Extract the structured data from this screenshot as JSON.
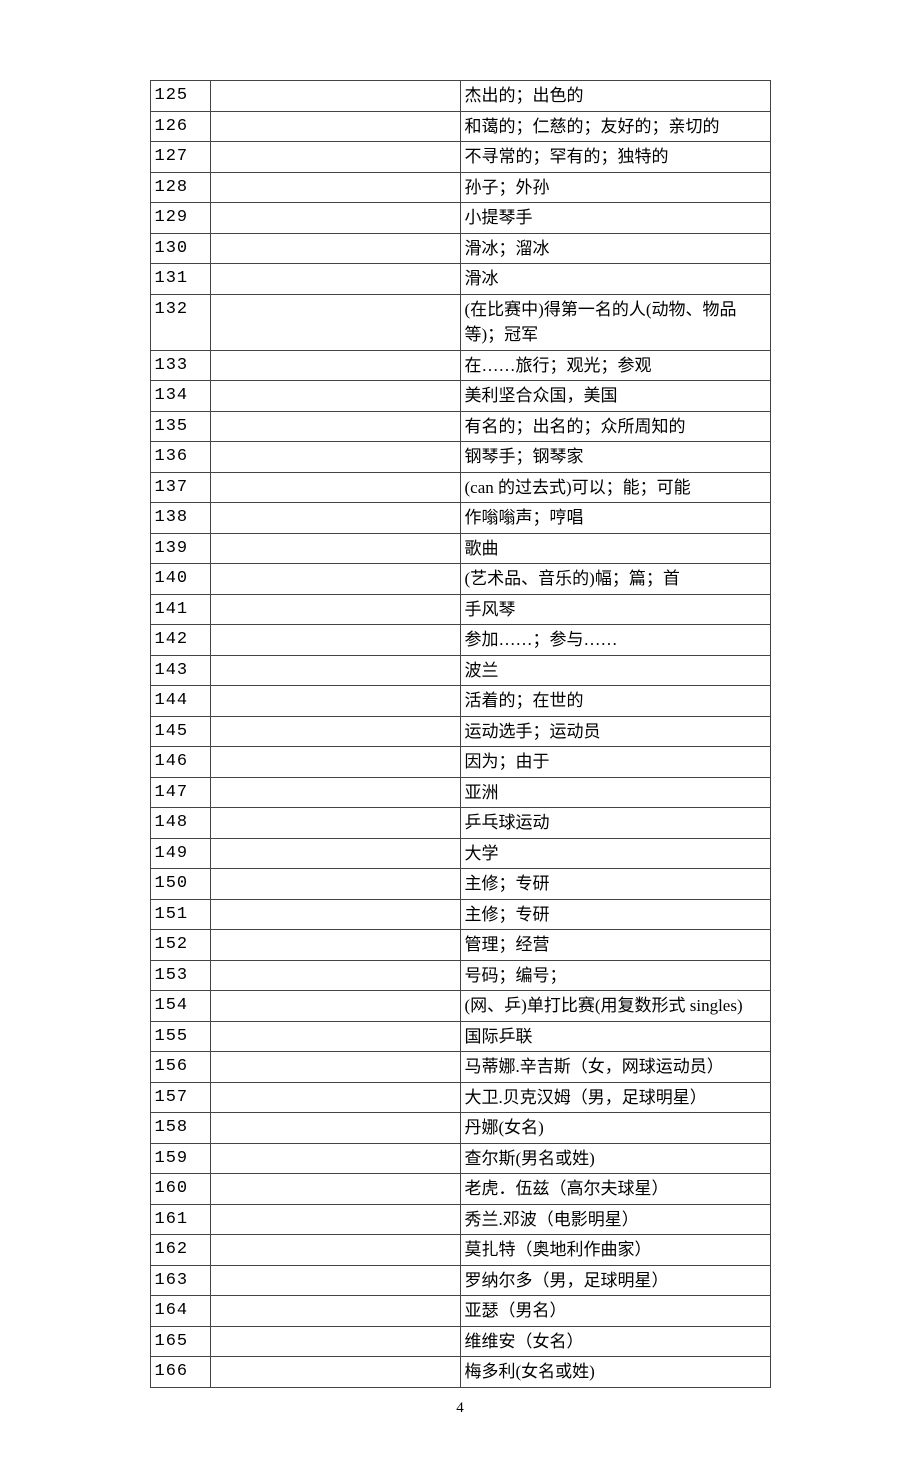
{
  "page_number": "4",
  "rows": [
    {
      "n": "125",
      "w": "",
      "d": "杰出的；出色的"
    },
    {
      "n": "126",
      "w": "",
      "d": "和蔼的；仁慈的；友好的；亲切的"
    },
    {
      "n": "127",
      "w": "",
      "d": "不寻常的；罕有的；独特的"
    },
    {
      "n": "128",
      "w": "",
      "d": "孙子；外孙"
    },
    {
      "n": "129",
      "w": "",
      "d": "小提琴手"
    },
    {
      "n": "130",
      "w": "",
      "d": "滑冰；溜冰"
    },
    {
      "n": "131",
      "w": "",
      "d": "滑冰"
    },
    {
      "n": "132",
      "w": "",
      "d": "(在比赛中)得第一名的人(动物、物品等)；冠军"
    },
    {
      "n": "133",
      "w": "",
      "d": "在……旅行；观光；参观"
    },
    {
      "n": "134",
      "w": "",
      "d": "美利坚合众国，美国"
    },
    {
      "n": "135",
      "w": "",
      "d": "有名的；出名的；众所周知的"
    },
    {
      "n": "136",
      "w": "",
      "d": "钢琴手；钢琴家"
    },
    {
      "n": "137",
      "w": "",
      "d": "(can 的过去式)可以；能；可能"
    },
    {
      "n": "138",
      "w": "",
      "d": "作嗡嗡声；哼唱"
    },
    {
      "n": "139",
      "w": "",
      "d": "歌曲"
    },
    {
      "n": "140",
      "w": "",
      "d": "(艺术品、音乐的)幅；篇；首"
    },
    {
      "n": "141",
      "w": "",
      "d": "手风琴"
    },
    {
      "n": "142",
      "w": "",
      "d": "参加……；参与……"
    },
    {
      "n": "143",
      "w": "",
      "d": "波兰"
    },
    {
      "n": "144",
      "w": "",
      "d": "活着的；在世的"
    },
    {
      "n": "145",
      "w": "",
      "d": "运动选手；运动员"
    },
    {
      "n": "146",
      "w": "",
      "d": "因为；由于"
    },
    {
      "n": "147",
      "w": "",
      "d": "亚洲"
    },
    {
      "n": "148",
      "w": "",
      "d": "乒乓球运动"
    },
    {
      "n": "149",
      "w": "",
      "d": "大学"
    },
    {
      "n": "150",
      "w": "",
      "d": "主修；专研"
    },
    {
      "n": "151",
      "w": "",
      "d": "主修；专研"
    },
    {
      "n": "152",
      "w": "",
      "d": "管理；经营"
    },
    {
      "n": "153",
      "w": "",
      "d": "号码；编号；"
    },
    {
      "n": "154",
      "w": "",
      "d": "(网、乒)单打比赛(用复数形式 singles)"
    },
    {
      "n": "155",
      "w": "",
      "d": "国际乒联"
    },
    {
      "n": "156",
      "w": "",
      "d": "马蒂娜.辛吉斯（女，网球运动员）"
    },
    {
      "n": "157",
      "w": "",
      "d": "大卫.贝克汉姆（男，足球明星）"
    },
    {
      "n": "158",
      "w": "",
      "d": "丹娜(女名)"
    },
    {
      "n": "159",
      "w": "",
      "d": "查尔斯(男名或姓)"
    },
    {
      "n": "160",
      "w": "",
      "d": "老虎．伍兹（高尔夫球星）"
    },
    {
      "n": "161",
      "w": "",
      "d": "秀兰.邓波（电影明星）"
    },
    {
      "n": "162",
      "w": "",
      "d": "莫扎特（奥地利作曲家）"
    },
    {
      "n": "163",
      "w": "",
      "d": "罗纳尔多（男，足球明星）"
    },
    {
      "n": "164",
      "w": "",
      "d": "亚瑟（男名）"
    },
    {
      "n": "165",
      "w": "",
      "d": "维维安（女名）"
    },
    {
      "n": "166",
      "w": "",
      "d": "梅多利(女名或姓)"
    }
  ]
}
